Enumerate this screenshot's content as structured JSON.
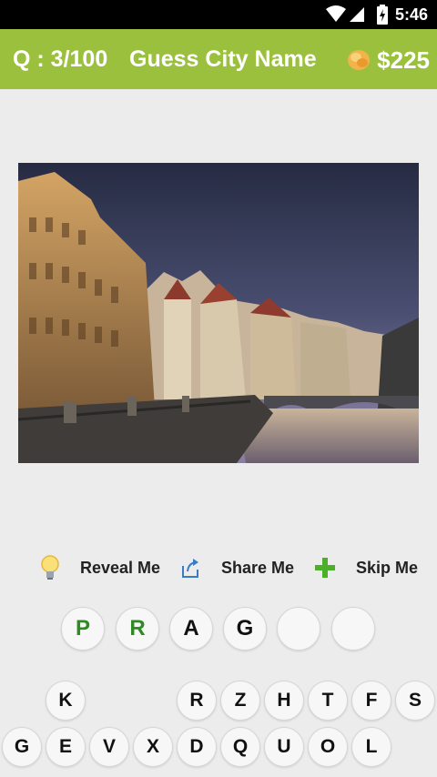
{
  "status_bar": {
    "time": "5:46"
  },
  "header": {
    "question_counter": "Q : 3/100",
    "title": "Guess City Name",
    "coins": "$225"
  },
  "actions": [
    {
      "label": "Reveal Me",
      "icon": "lightbulb-icon"
    },
    {
      "label": "Share Me",
      "icon": "share-icon"
    },
    {
      "label": "Skip Me",
      "icon": "plus-icon"
    }
  ],
  "answer_slots": [
    {
      "letter": "P",
      "revealed": true
    },
    {
      "letter": "R",
      "revealed": true
    },
    {
      "letter": "A",
      "revealed": false
    },
    {
      "letter": "G",
      "revealed": false
    },
    {
      "letter": "",
      "revealed": false
    },
    {
      "letter": "",
      "revealed": false
    }
  ],
  "keyboard": {
    "row1": [
      "K",
      "R",
      "Z",
      "H",
      "T",
      "F",
      "S"
    ],
    "row2": [
      "G",
      "E",
      "V",
      "X",
      "D",
      "Q",
      "U",
      "O",
      "L"
    ]
  },
  "colors": {
    "header": "#9bc03d",
    "revealed_letter": "#2e8b22",
    "background": "#ececec"
  }
}
